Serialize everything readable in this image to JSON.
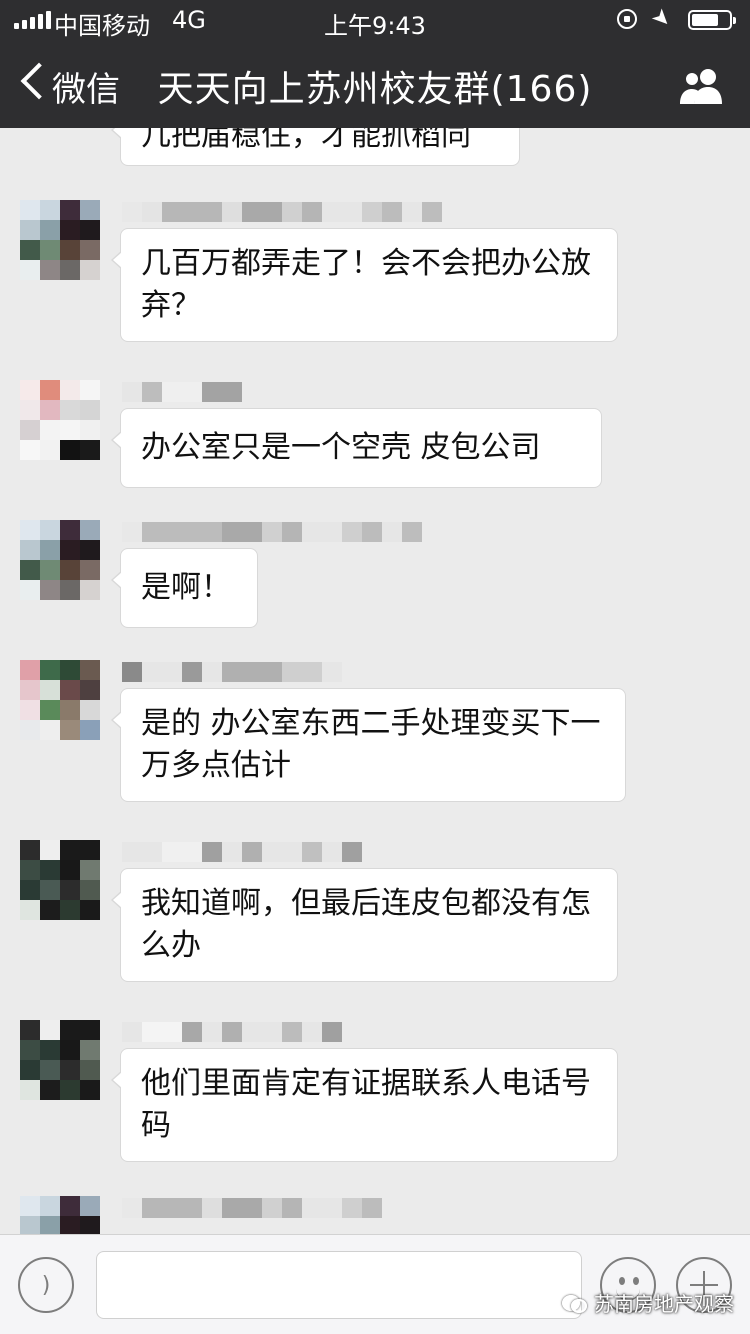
{
  "status_bar": {
    "carrier": "中国移动",
    "network": "4G",
    "time": "上午9:43"
  },
  "nav": {
    "back_label": "微信",
    "title": "天天向上苏州校友群(166)",
    "group_icon": "group-members-icon"
  },
  "messages": [
    {
      "text": "几把届稳住，才能抓稻同"
    },
    {
      "text": "几百万都弄走了！会不会把办公放弃？"
    },
    {
      "text": "办公室只是一个空壳 皮包公司"
    },
    {
      "text": "是啊！"
    },
    {
      "text": "是的 办公室东西二手处理变买下一万多点估计"
    },
    {
      "text": "我知道啊，但最后连皮包都没有怎么办"
    },
    {
      "text": "他们里面肯定有证据联系人电话号码"
    }
  ],
  "input_bar": {
    "voice_icon": "voice-icon",
    "emoji_icon": "emoji-icon",
    "plus_icon": "plus-icon"
  },
  "watermark": "苏南房地产观察",
  "colors": {
    "nav_background": "#2e2e30",
    "chat_background": "#ebebeb",
    "bubble": "#ffffff"
  }
}
